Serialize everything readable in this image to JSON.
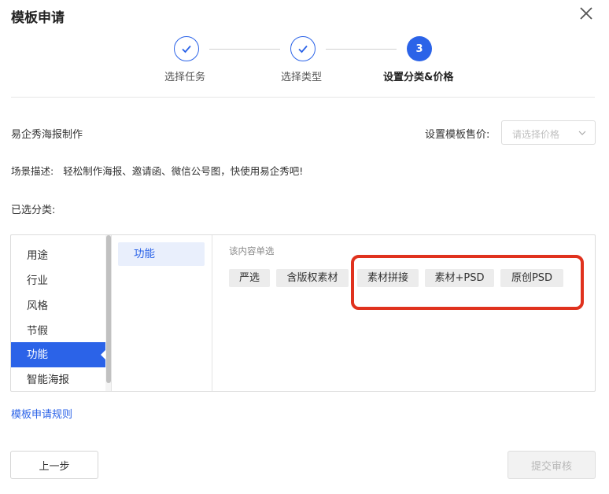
{
  "dialog": {
    "title": "模板申请",
    "close_icon": "close-icon"
  },
  "steps": [
    {
      "label": "选择任务",
      "state": "done",
      "icon": "check-icon"
    },
    {
      "label": "选择类型",
      "state": "done",
      "icon": "check-icon"
    },
    {
      "label": "设置分类&价格",
      "state": "active",
      "number": "3"
    }
  ],
  "form": {
    "app_name": "易企秀海报制作",
    "price_label": "设置模板售价:",
    "price_placeholder": "请选择价格",
    "desc_label": "场景描述:",
    "desc_text": "轻松制作海报、邀请函、微信公号图，快使用易企秀吧!",
    "selected_label": "已选分类:"
  },
  "categories": {
    "items": [
      "用途",
      "行业",
      "风格",
      "节假",
      "功能",
      "智能海报"
    ],
    "active": "功能",
    "sub_items": [
      "功能"
    ],
    "active_sub": "功能",
    "hint": "该内容单选",
    "tags": [
      "严选",
      "含版权素材",
      "素材拼接",
      "素材+PSD",
      "原创PSD"
    ]
  },
  "links": {
    "rules": "模板申请规则"
  },
  "footer": {
    "prev_label": "上一步",
    "submit_label": "提交审核"
  },
  "colors": {
    "accent": "#2b63e8",
    "highlight": "#e0321e",
    "tag_bg": "#ececec"
  }
}
